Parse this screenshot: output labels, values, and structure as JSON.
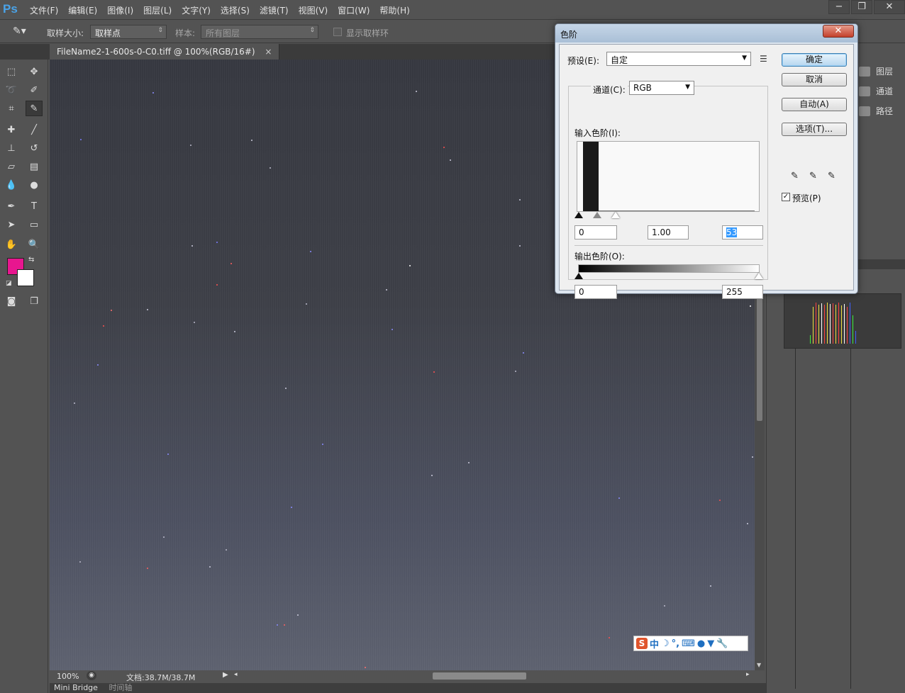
{
  "app": {
    "logo": "Ps"
  },
  "menu": [
    "文件(F)",
    "编辑(E)",
    "图像(I)",
    "图层(L)",
    "文字(Y)",
    "选择(S)",
    "滤镜(T)",
    "视图(V)",
    "窗口(W)",
    "帮助(H)"
  ],
  "window_controls": {
    "minimize": "−",
    "restore": "❐",
    "close": "✕"
  },
  "options_bar": {
    "sample_size_label": "取样大小:",
    "sample_size_value": "取样点",
    "sample_label": "样本:",
    "sample_value": "所有图层",
    "show_ring_label": "显示取样环"
  },
  "document": {
    "tab_title": "FileName2-1-600s-0-C0.tiff @ 100%(RGB/16#)",
    "close": "×"
  },
  "status": {
    "zoom": "100%",
    "doc_info": "文档:38.7M/38.7M"
  },
  "bottom_tabs": [
    "Mini Bridge",
    "时间轴"
  ],
  "right_panel": {
    "items": [
      "图层",
      "通道",
      "路径"
    ]
  },
  "levels_dialog": {
    "title": "色阶",
    "close": "✕",
    "preset_label": "预设(E):",
    "preset_value": "自定",
    "channel_label": "通道(C):",
    "channel_value": "RGB",
    "input_levels_label": "输入色阶(I):",
    "input_black": "0",
    "input_gamma": "1.00",
    "input_white": "53",
    "output_levels_label": "输出色阶(O):",
    "output_black": "0",
    "output_white": "255",
    "buttons": {
      "ok": "确定",
      "cancel": "取消",
      "auto": "自动(A)",
      "options": "选项(T)..."
    },
    "preview_label": "预览(P)",
    "preview_checked": true
  },
  "ime_bar": {
    "logo": "S",
    "mode": "中"
  }
}
